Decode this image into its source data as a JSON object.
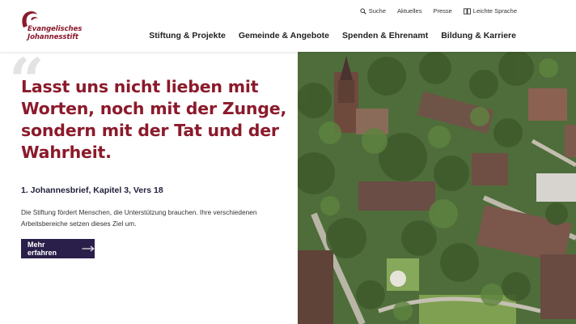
{
  "logo": {
    "line1": "Evangelisches",
    "line2": "Johannesstift"
  },
  "utility_nav": [
    {
      "label": "Suche",
      "icon": "search-icon"
    },
    {
      "label": "Aktuelles"
    },
    {
      "label": "Presse"
    },
    {
      "label": "Leichte Sprache",
      "icon": "book-icon"
    }
  ],
  "main_nav": [
    {
      "label": "Stiftung & Projekte"
    },
    {
      "label": "Gemeinde & Angebote"
    },
    {
      "label": "Spenden & Ehrenamt"
    },
    {
      "label": "Bildung & Karriere"
    }
  ],
  "hero": {
    "quote_mark": "“",
    "quote": "Lasst uns nicht lieben mit Worten, noch mit der Zunge, sondern mit der Tat und der Wahrheit.",
    "source": "1. Johannesbrief, Kapitel 3, Vers 18",
    "description": "Die Stiftung fördert Menschen, die Unterstützung brauchen. Ihre verschiedenen Arbeitsbereiche setzen dieses Ziel um.",
    "cta_label": "Mehr erfahren",
    "cta_icon": "arrow-right-icon",
    "image_alt": "Luftaufnahme des Stiftsgeländes"
  },
  "colors": {
    "brand_red": "#8b1a2b",
    "cta_bg": "#2a1f4a",
    "header_bg": "#ffffff"
  }
}
